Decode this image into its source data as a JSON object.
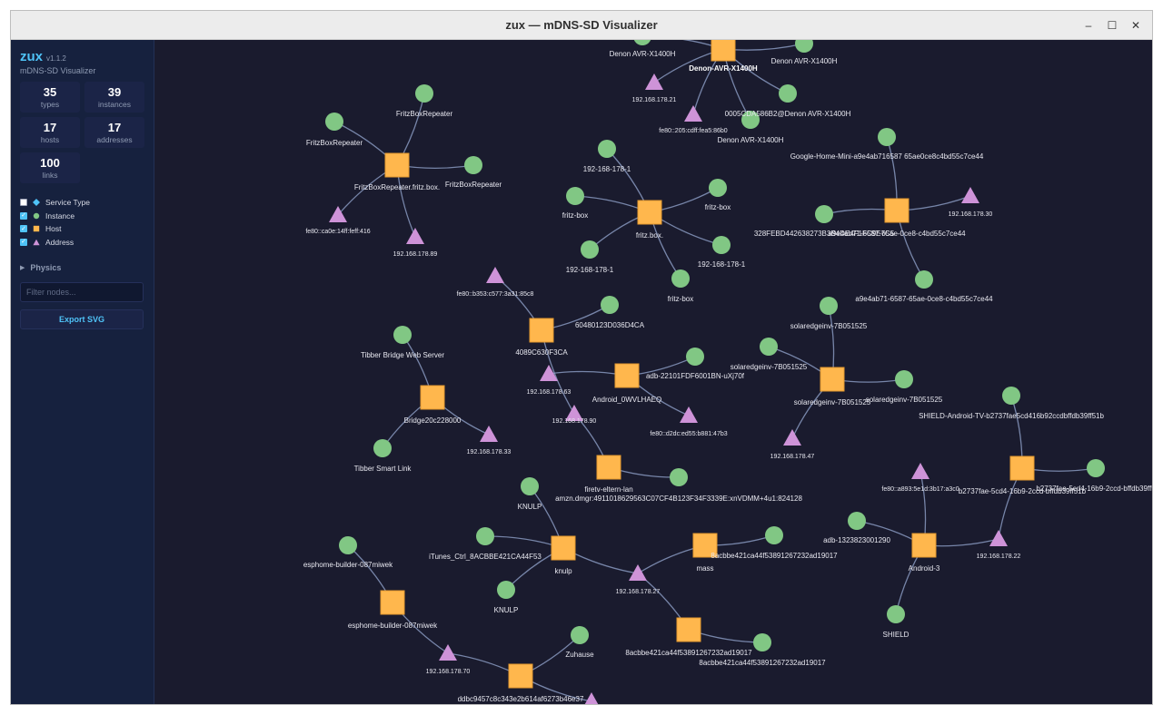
{
  "window": {
    "title": "zux — mDNS-SD Visualizer",
    "min_glyph": "–",
    "max_glyph": "☐",
    "close_glyph": "✕"
  },
  "sidebar": {
    "name": "zux",
    "version": "v1.1.2",
    "subtitle": "mDNS-SD Visualizer",
    "stats": [
      {
        "value": "35",
        "label": "types"
      },
      {
        "value": "39",
        "label": "instances"
      },
      {
        "value": "17",
        "label": "hosts"
      },
      {
        "value": "17",
        "label": "addresses"
      },
      {
        "value": "100",
        "label": "links"
      }
    ],
    "legend": [
      {
        "label": "Service Type",
        "checked": false,
        "color": "#4fc3f7",
        "icon": "diamond-icon"
      },
      {
        "label": "Instance",
        "checked": true,
        "color": "#81c784",
        "icon": "circle-icon"
      },
      {
        "label": "Host",
        "checked": true,
        "color": "#ffb74d",
        "icon": "square-icon"
      },
      {
        "label": "Address",
        "checked": true,
        "color": "#ce93d8",
        "icon": "triangle-icon"
      }
    ],
    "physics_label": "Physics",
    "filter_placeholder": "Filter nodes...",
    "export_label": "Export SVG"
  },
  "colors": {
    "background": "#1a1b2e",
    "sidebar": "#16213e",
    "accent": "#4fc3f7",
    "instance": "#81c784",
    "host": "#ffb74d",
    "address": "#ce93d8",
    "edge": "#8fa0c8"
  },
  "graph": {
    "nodes": [
      {
        "id": "h_denon",
        "type": "host",
        "label": "Denon-AVR-X1400H",
        "bold": true
      },
      {
        "id": "i_denon1",
        "type": "instance",
        "label": "Denon AVR-X1400H"
      },
      {
        "id": "i_denon2",
        "type": "instance",
        "label": "Denon AVR-X1400H"
      },
      {
        "id": "i_denon3",
        "type": "instance",
        "label": "0005CDA586B2@Denon AVR-X1400H"
      },
      {
        "id": "i_denon4",
        "type": "instance",
        "label": "Denon AVR-X1400H"
      },
      {
        "id": "a_denon1",
        "type": "address",
        "label": "192.168.178.21"
      },
      {
        "id": "a_denon2",
        "type": "address",
        "label": "fe80::205:cdff:fea5:86b0"
      },
      {
        "id": "h_fritzrep",
        "type": "host",
        "label": "FritzBoxRepeater.fritz.box."
      },
      {
        "id": "i_fr1",
        "type": "instance",
        "label": "FritzBoxRepeater"
      },
      {
        "id": "i_fr2",
        "type": "instance",
        "label": "FritzBoxRepeater"
      },
      {
        "id": "i_fr3",
        "type": "instance",
        "label": "FritzBoxRepeater"
      },
      {
        "id": "a_fr1",
        "type": "address",
        "label": "fe80::ca0e:14ff:feff:416"
      },
      {
        "id": "a_fr2",
        "type": "address",
        "label": "192.168.178.89"
      },
      {
        "id": "h_fritz",
        "type": "host",
        "label": "fritz.box."
      },
      {
        "id": "i_fb1",
        "type": "instance",
        "label": "192-168-178-1"
      },
      {
        "id": "i_fb2",
        "type": "instance",
        "label": "fritz-box"
      },
      {
        "id": "i_fb3",
        "type": "instance",
        "label": "fritz-box"
      },
      {
        "id": "i_fb4",
        "type": "instance",
        "label": "192-168-178-1"
      },
      {
        "id": "i_fb5",
        "type": "instance",
        "label": "192-168-178-1"
      },
      {
        "id": "i_fb6",
        "type": "instance",
        "label": "fritz-box"
      },
      {
        "id": "h_google",
        "type": "host",
        "label": "a9e4ab71-6587-65ae-0ce8-c4bd55c7ce44"
      },
      {
        "id": "i_gg1",
        "type": "instance",
        "label": "Google-Home-Mini-a9e4ab716587 65ae0ce8c4bd55c7ce44"
      },
      {
        "id": "i_gg2",
        "type": "instance",
        "label": "328FEBD442638273B3B4DE4F1FC9E7C5"
      },
      {
        "id": "i_gg3",
        "type": "instance",
        "label": "a9e4ab71-6587-65ae-0ce8-c4bd55c7ce44"
      },
      {
        "id": "a_gg1",
        "type": "address",
        "label": "192.168.178.30"
      },
      {
        "id": "h_4089",
        "type": "host",
        "label": "4089C630F3CA"
      },
      {
        "id": "i_6048",
        "type": "instance",
        "label": "60480123D036D4CA"
      },
      {
        "id": "a_4089",
        "type": "address",
        "label": "fe80::b353:c577:3a31:85c8"
      },
      {
        "id": "h_tibber",
        "type": "host",
        "label": "Bridge20c228000"
      },
      {
        "id": "i_tb1",
        "type": "instance",
        "label": "Tibber Bridge Web Server"
      },
      {
        "id": "i_tb2",
        "type": "instance",
        "label": "Tibber Smart Link"
      },
      {
        "id": "a_tb1",
        "type": "address",
        "label": "192.168.178.33"
      },
      {
        "id": "h_android0",
        "type": "host",
        "label": "Android_0WVLHAEQ"
      },
      {
        "id": "i_adb1",
        "type": "instance",
        "label": "adb-22101FDF6001BN-uXj70f"
      },
      {
        "id": "a_an1",
        "type": "address",
        "label": "192.168.178.63"
      },
      {
        "id": "a_an2",
        "type": "address",
        "label": "fe80::d2dc:ed55:b881:47b3"
      },
      {
        "id": "a_an3",
        "type": "address",
        "label": "192.168.178.90"
      },
      {
        "id": "h_firetv",
        "type": "host",
        "label": "firetv-eltern-lan"
      },
      {
        "id": "i_amzn",
        "type": "instance",
        "label": "amzn.dmgr:4911018629563C07CF4B123F34F3339E:xnVDMM+4u1:824128"
      },
      {
        "id": "h_solar",
        "type": "host",
        "label": "solaredgeinv-7B051525"
      },
      {
        "id": "i_so1",
        "type": "instance",
        "label": "solaredgeinv-7B051525"
      },
      {
        "id": "i_so2",
        "type": "instance",
        "label": "solaredgeinv-7B051525"
      },
      {
        "id": "i_so3",
        "type": "instance",
        "label": "solaredgeinv-7B051525"
      },
      {
        "id": "a_so1",
        "type": "address",
        "label": "192.168.178.47"
      },
      {
        "id": "h_shield",
        "type": "host",
        "label": "b2737fae-5cd4-16b9-2ccd-bffdb39ff51b"
      },
      {
        "id": "i_sh1",
        "type": "instance",
        "label": "SHIELD-Android-TV-b2737fae5cd416b92ccdbffdb39ff51b"
      },
      {
        "id": "i_sh2",
        "type": "instance",
        "label": "b2737fae-5cd4-16b9-2ccd-bffdb39ff5"
      },
      {
        "id": "a_sh1",
        "type": "address",
        "label": "192.168.178.22"
      },
      {
        "id": "h_android3",
        "type": "host",
        "label": "Android-3"
      },
      {
        "id": "i_a3a",
        "type": "instance",
        "label": "adb-1323823001290"
      },
      {
        "id": "i_a3b",
        "type": "instance",
        "label": "SHIELD"
      },
      {
        "id": "a_a3a",
        "type": "address",
        "label": "fe80::a893:5e1d:3b17:a3c0"
      },
      {
        "id": "h_knulp",
        "type": "host",
        "label": "knulp"
      },
      {
        "id": "i_kn1",
        "type": "instance",
        "label": "KNULP"
      },
      {
        "id": "i_kn2",
        "type": "instance",
        "label": "iTunes_Ctrl_8ACBBE421CA44F53"
      },
      {
        "id": "i_kn3",
        "type": "instance",
        "label": "KNULP"
      },
      {
        "id": "a_kn1",
        "type": "address",
        "label": "192.168.178.27"
      },
      {
        "id": "h_mass",
        "type": "host",
        "label": "mass"
      },
      {
        "id": "i_ms1",
        "type": "instance",
        "label": "8acbbe421ca44f53891267232ad19017"
      },
      {
        "id": "h_8acb",
        "type": "host",
        "label": "8acbbe421ca44f53891267232ad19017"
      },
      {
        "id": "i_8a1",
        "type": "instance",
        "label": "8acbbe421ca44f53891267232ad19017"
      },
      {
        "id": "h_esp",
        "type": "host",
        "label": "esphome-builder-087miwek"
      },
      {
        "id": "i_esp1",
        "type": "instance",
        "label": "esphome-builder-087miwek"
      },
      {
        "id": "a_esp1",
        "type": "address",
        "label": "192.168.178.70"
      },
      {
        "id": "h_ddbc",
        "type": "host",
        "label": "ddbc9457c8c343e2b614af6273b46e37"
      },
      {
        "id": "i_zu",
        "type": "instance",
        "label": "Zuhause"
      },
      {
        "id": "a_dd1",
        "type": "address",
        "label": ""
      }
    ],
    "edges": [
      [
        "h_denon",
        "i_denon1"
      ],
      [
        "h_denon",
        "i_denon2"
      ],
      [
        "h_denon",
        "i_denon3"
      ],
      [
        "h_denon",
        "i_denon4"
      ],
      [
        "h_denon",
        "a_denon1"
      ],
      [
        "h_denon",
        "a_denon2"
      ],
      [
        "h_fritzrep",
        "i_fr1"
      ],
      [
        "h_fritzrep",
        "i_fr2"
      ],
      [
        "h_fritzrep",
        "i_fr3"
      ],
      [
        "h_fritzrep",
        "a_fr1"
      ],
      [
        "h_fritzrep",
        "a_fr2"
      ],
      [
        "h_fritz",
        "i_fb1"
      ],
      [
        "h_fritz",
        "i_fb2"
      ],
      [
        "h_fritz",
        "i_fb3"
      ],
      [
        "h_fritz",
        "i_fb4"
      ],
      [
        "h_fritz",
        "i_fb5"
      ],
      [
        "h_fritz",
        "i_fb6"
      ],
      [
        "h_google",
        "i_gg1"
      ],
      [
        "h_google",
        "i_gg2"
      ],
      [
        "h_google",
        "i_gg3"
      ],
      [
        "h_google",
        "a_gg1"
      ],
      [
        "h_4089",
        "i_6048"
      ],
      [
        "h_4089",
        "a_4089"
      ],
      [
        "h_4089",
        "a_an3"
      ],
      [
        "h_tibber",
        "i_tb1"
      ],
      [
        "h_tibber",
        "i_tb2"
      ],
      [
        "h_tibber",
        "a_tb1"
      ],
      [
        "h_android0",
        "i_adb1"
      ],
      [
        "h_android0",
        "a_an1"
      ],
      [
        "h_android0",
        "a_an2"
      ],
      [
        "h_firetv",
        "i_amzn"
      ],
      [
        "h_firetv",
        "a_an3"
      ],
      [
        "h_solar",
        "i_so1"
      ],
      [
        "h_solar",
        "i_so2"
      ],
      [
        "h_solar",
        "i_so3"
      ],
      [
        "h_solar",
        "a_so1"
      ],
      [
        "h_shield",
        "i_sh1"
      ],
      [
        "h_shield",
        "i_sh2"
      ],
      [
        "h_shield",
        "a_sh1"
      ],
      [
        "h_android3",
        "i_a3a"
      ],
      [
        "h_android3",
        "i_a3b"
      ],
      [
        "h_android3",
        "a_a3a"
      ],
      [
        "h_android3",
        "a_sh1"
      ],
      [
        "h_knulp",
        "i_kn1"
      ],
      [
        "h_knulp",
        "i_kn2"
      ],
      [
        "h_knulp",
        "i_kn3"
      ],
      [
        "h_knulp",
        "a_kn1"
      ],
      [
        "h_mass",
        "i_ms1"
      ],
      [
        "h_mass",
        "a_kn1"
      ],
      [
        "h_8acb",
        "i_8a1"
      ],
      [
        "h_8acb",
        "a_kn1"
      ],
      [
        "h_esp",
        "i_esp1"
      ],
      [
        "h_esp",
        "a_esp1"
      ],
      [
        "h_ddbc",
        "i_zu"
      ],
      [
        "h_ddbc",
        "a_esp1"
      ],
      [
        "h_ddbc",
        "a_dd1"
      ]
    ]
  }
}
